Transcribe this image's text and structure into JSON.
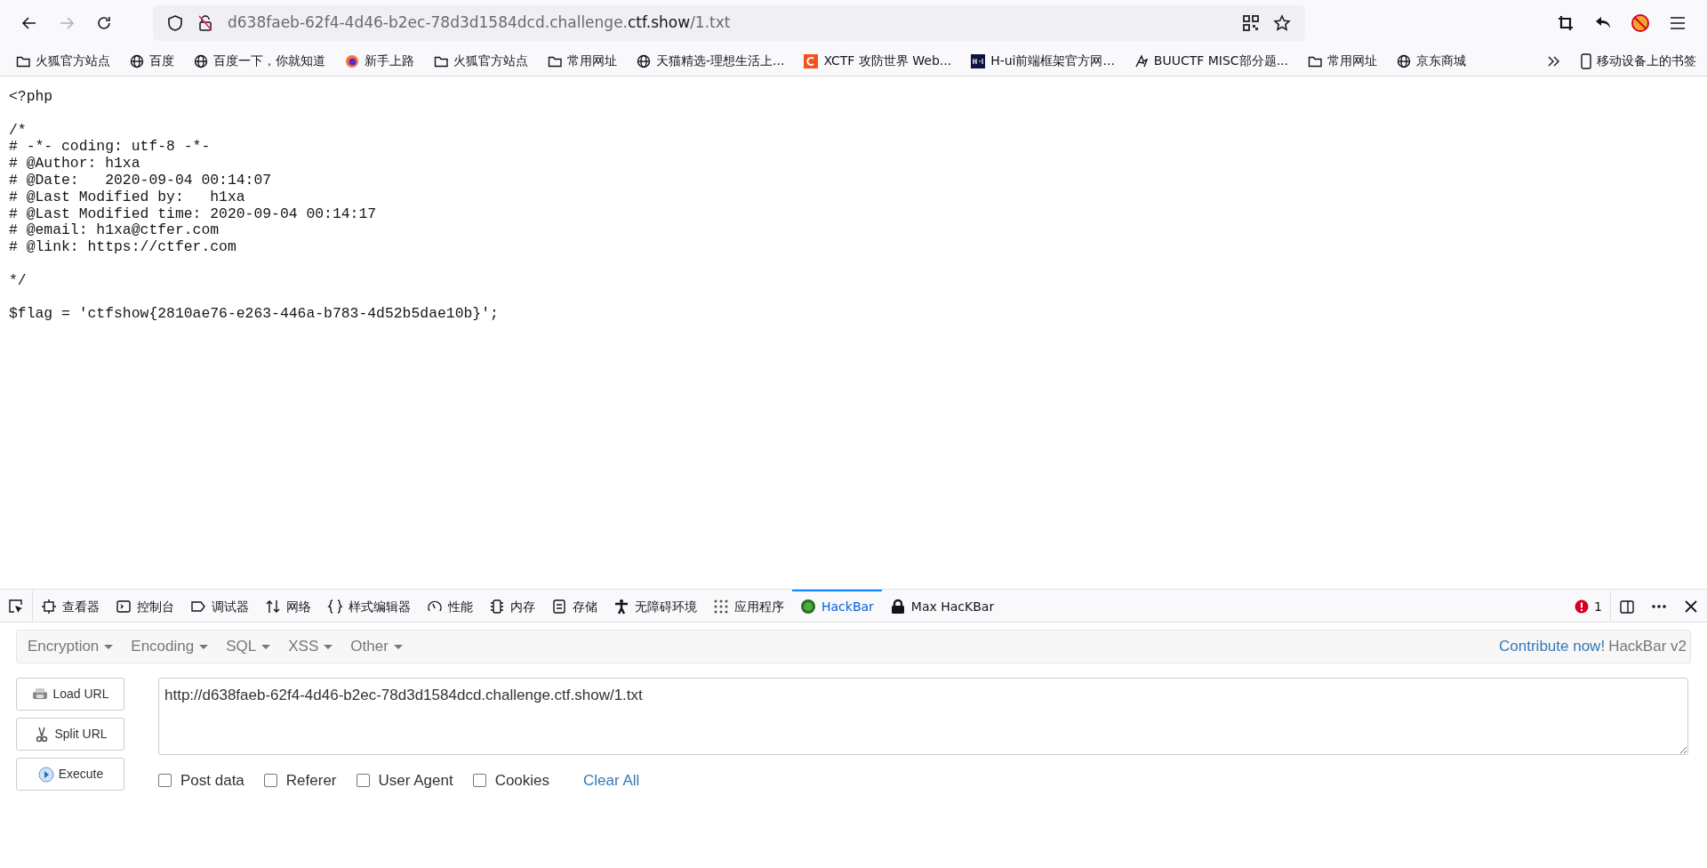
{
  "browser": {
    "url_prefix": "d638faeb-62f4-4d46-b2ec-78d3d1584dcd.challenge.",
    "url_domain": "ctf.show",
    "url_suffix": "/1.txt"
  },
  "bookmarks": [
    {
      "kind": "folder",
      "label": "火狐官方站点"
    },
    {
      "kind": "globe",
      "label": "百度"
    },
    {
      "kind": "globe",
      "label": "百度一下，你就知道"
    },
    {
      "kind": "firefox",
      "label": "新手上路"
    },
    {
      "kind": "folder",
      "label": "火狐官方站点"
    },
    {
      "kind": "folder",
      "label": "常用网址"
    },
    {
      "kind": "globe",
      "label": "天猫精选-理想生活上..."
    },
    {
      "kind": "clogo",
      "label": "XCTF 攻防世界 Web..."
    },
    {
      "kind": "hui",
      "label": "H-ui前端框架官方网..."
    },
    {
      "kind": "buu",
      "label": "BUUCTF MISC部分题..."
    },
    {
      "kind": "folder",
      "label": "常用网址"
    },
    {
      "kind": "globe",
      "label": "京东商城"
    }
  ],
  "mobile_bookmarks": "移动设备上的书签",
  "code_blocks": [
    [
      "<?php"
    ],
    [
      "/*",
      "# -*- coding: utf-8 -*-",
      "# @Author: h1xa",
      "# @Date:   2020-09-04 00:14:07",
      "# @Last Modified by:   h1xa",
      "# @Last Modified time: 2020-09-04 00:14:17",
      "# @email: h1xa@ctfer.com",
      "# @link: https://ctfer.com"
    ],
    [
      "*/"
    ],
    [
      "$flag = 'ctfshow{2810ae76-e263-446a-b783-4d52b5dae10b}';"
    ]
  ],
  "devtools": {
    "tabs": [
      {
        "kind": "inspector",
        "label": "查看器",
        "selected": false
      },
      {
        "kind": "console",
        "label": "控制台",
        "selected": false
      },
      {
        "kind": "debugger",
        "label": "调试器",
        "selected": false
      },
      {
        "kind": "network",
        "label": "网络",
        "selected": false
      },
      {
        "kind": "braces",
        "label": "样式编辑器",
        "selected": false
      },
      {
        "kind": "gauge",
        "label": "性能",
        "selected": false
      },
      {
        "kind": "chip",
        "label": "内存",
        "selected": false
      },
      {
        "kind": "storage",
        "label": "存储",
        "selected": false
      },
      {
        "kind": "person",
        "label": "无障碍环境",
        "selected": false
      },
      {
        "kind": "grid",
        "label": "应用程序",
        "selected": false
      },
      {
        "kind": "hackbar",
        "label": "HackBar",
        "selected": true
      },
      {
        "kind": "lock",
        "label": "Max HacKBar",
        "selected": false
      }
    ],
    "error_count": "1"
  },
  "hackbar": {
    "menus": [
      "Encryption",
      "Encoding",
      "SQL",
      "XSS",
      "Other"
    ],
    "contribute_link": "Contribute now!",
    "version": "HackBar v2",
    "actions": [
      {
        "kind": "load",
        "label": "Load URL"
      },
      {
        "kind": "split",
        "label": "Split URL"
      },
      {
        "kind": "execute",
        "label": "Execute"
      }
    ],
    "url_value": "http://d638faeb-62f4-4d46-b2ec-78d3d1584dcd.challenge.ctf.show/1.txt",
    "options": [
      {
        "label": "Post data",
        "checked": false
      },
      {
        "label": "Referer",
        "checked": false
      },
      {
        "label": "User Agent",
        "checked": false
      },
      {
        "label": "Cookies",
        "checked": false
      }
    ],
    "clear_link": "Clear All"
  }
}
